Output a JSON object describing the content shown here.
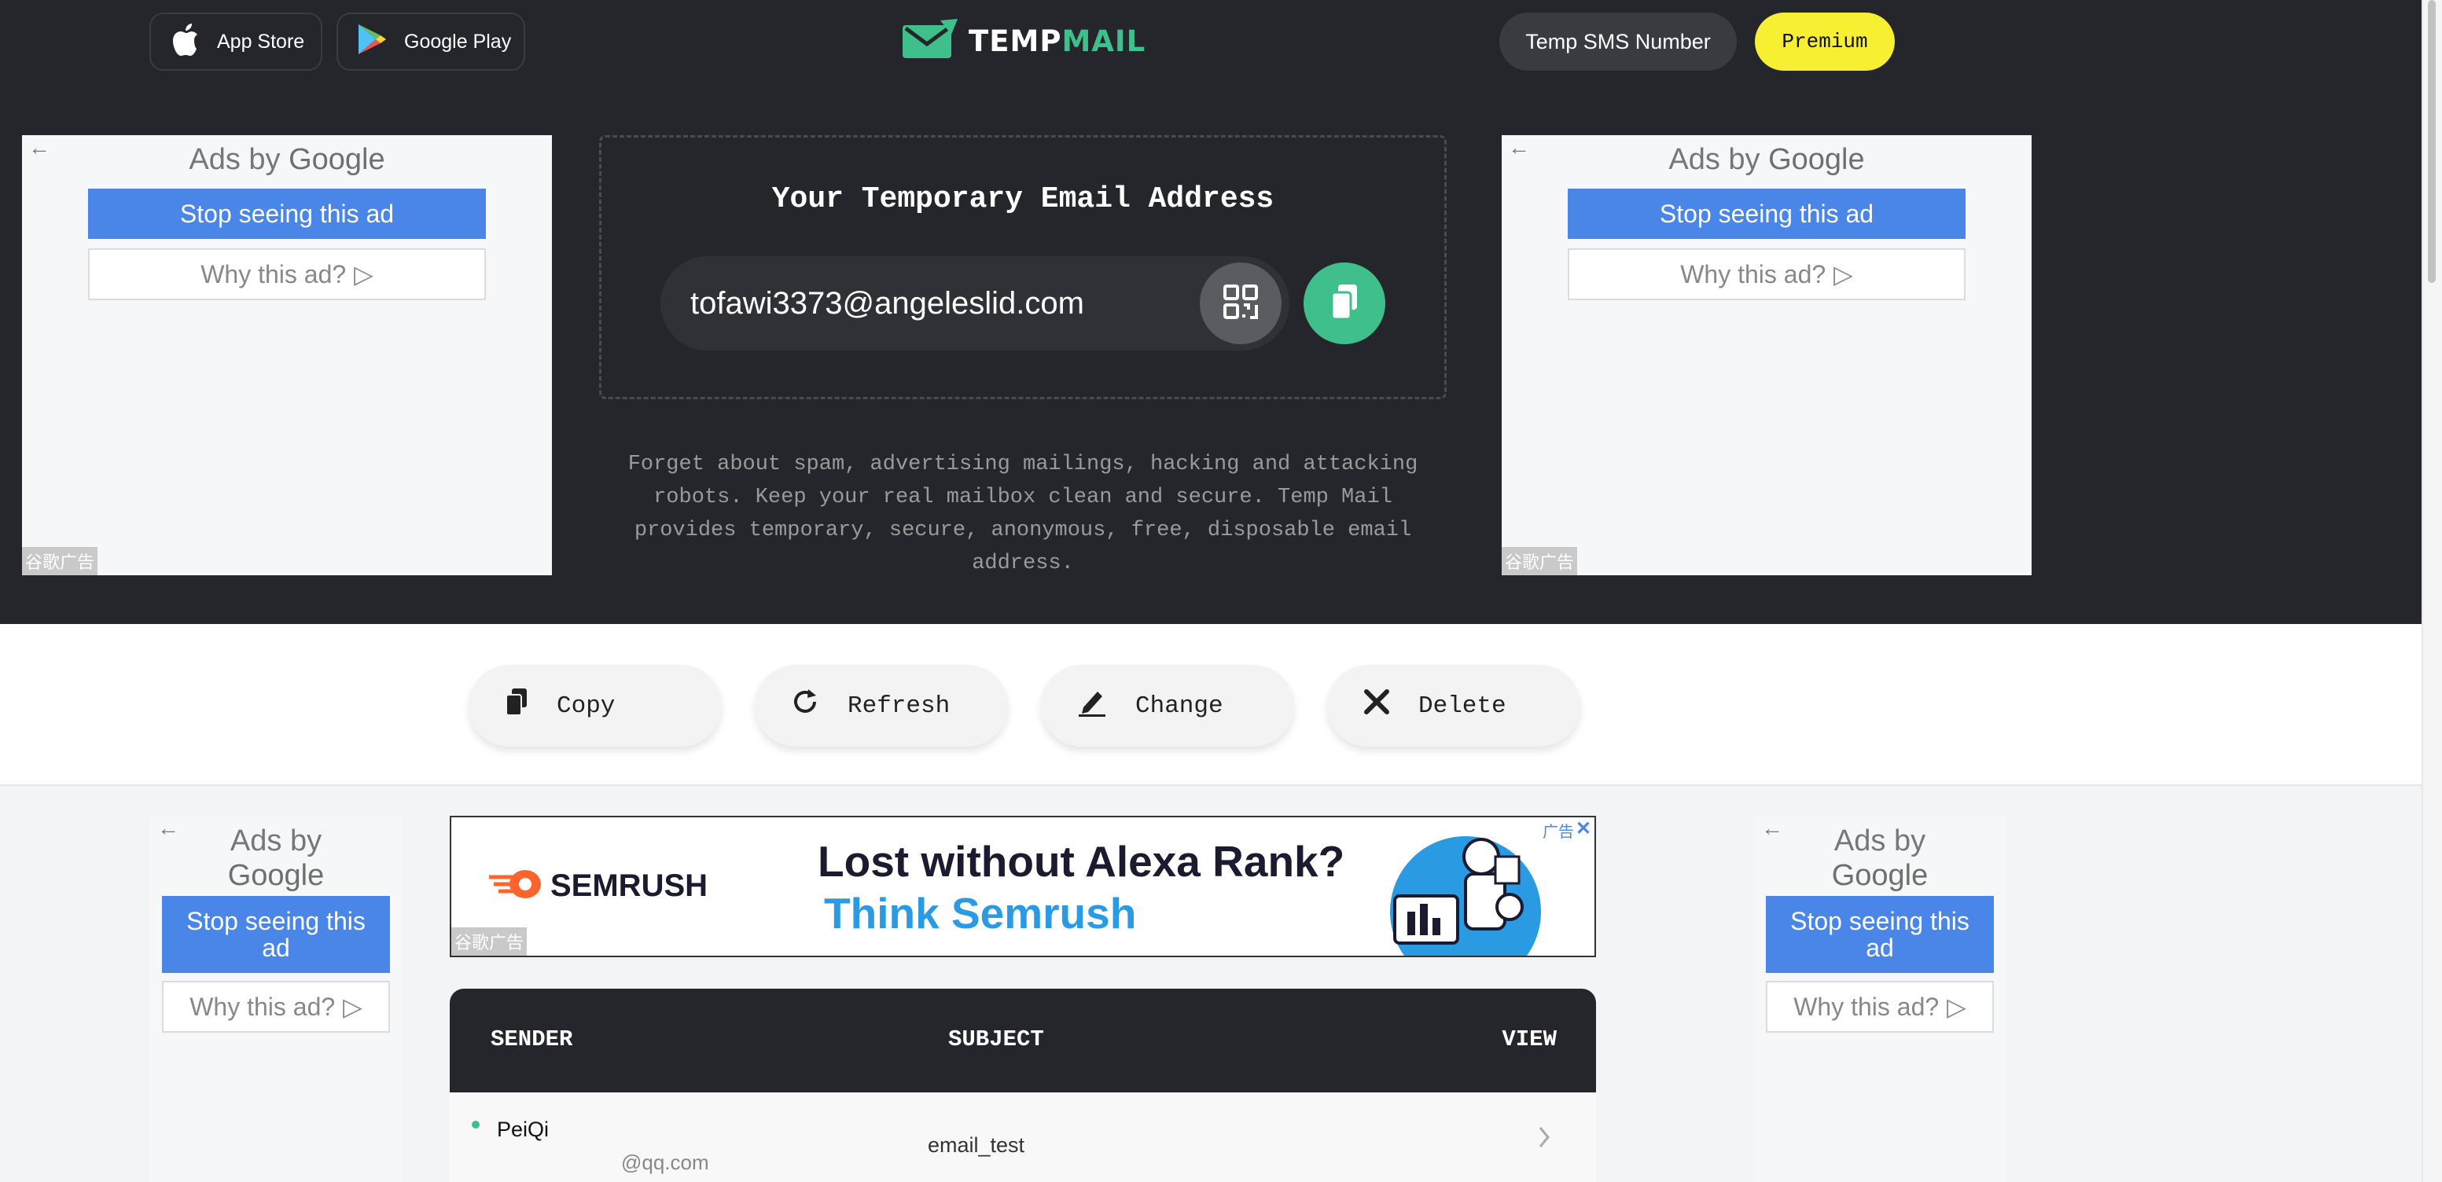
{
  "header": {
    "app_store_label": "App Store",
    "google_play_label": "Google Play",
    "logo_text_part1": "TEMP",
    "logo_text_part2": "MAIL",
    "temp_sms_label": "Temp SMS Number",
    "premium_label": "Premium"
  },
  "ads": {
    "ads_by_prefix": "Ads by",
    "ads_by_brand": "Google",
    "stop_seeing": "Stop seeing this ad",
    "stop_seeing_line1": "Stop seeing this",
    "stop_seeing_line2": "ad",
    "why_this_ad": "Why this ad?",
    "ad_tag": "谷歌广告",
    "back_arrow": "←"
  },
  "email_box": {
    "title": "Your Temporary Email Address",
    "address": "tofawi3373@angeleslid.com",
    "tagline": "Forget about spam, advertising mailings, hacking and attacking robots. Keep your real mailbox clean and secure. Temp Mail provides temporary, secure, anonymous, free, disposable email address."
  },
  "actions": {
    "copy": "Copy",
    "refresh": "Refresh",
    "change": "Change",
    "delete": "Delete"
  },
  "banner": {
    "brand": "SEMRUSH",
    "headline": "Lost without Alexa Rank?",
    "subline": "Think Semrush",
    "ad_label": "广告",
    "ad_tag": "谷歌广告",
    "colors": {
      "accent": "#ff642d",
      "headline": "#1b1b2f",
      "subline": "#2a9ae2"
    }
  },
  "inbox": {
    "col_sender": "SENDER",
    "col_subject": "SUBJECT",
    "col_view": "VIEW",
    "rows": [
      {
        "sender_name": "PeiQi",
        "sender_email": "@qq.com",
        "subject": "email_test"
      }
    ]
  },
  "colors": {
    "header_bg": "#25262b",
    "brand_green": "#3fbf8b",
    "premium_yellow": "#f7f032",
    "ad_blue": "#4a86e8"
  }
}
